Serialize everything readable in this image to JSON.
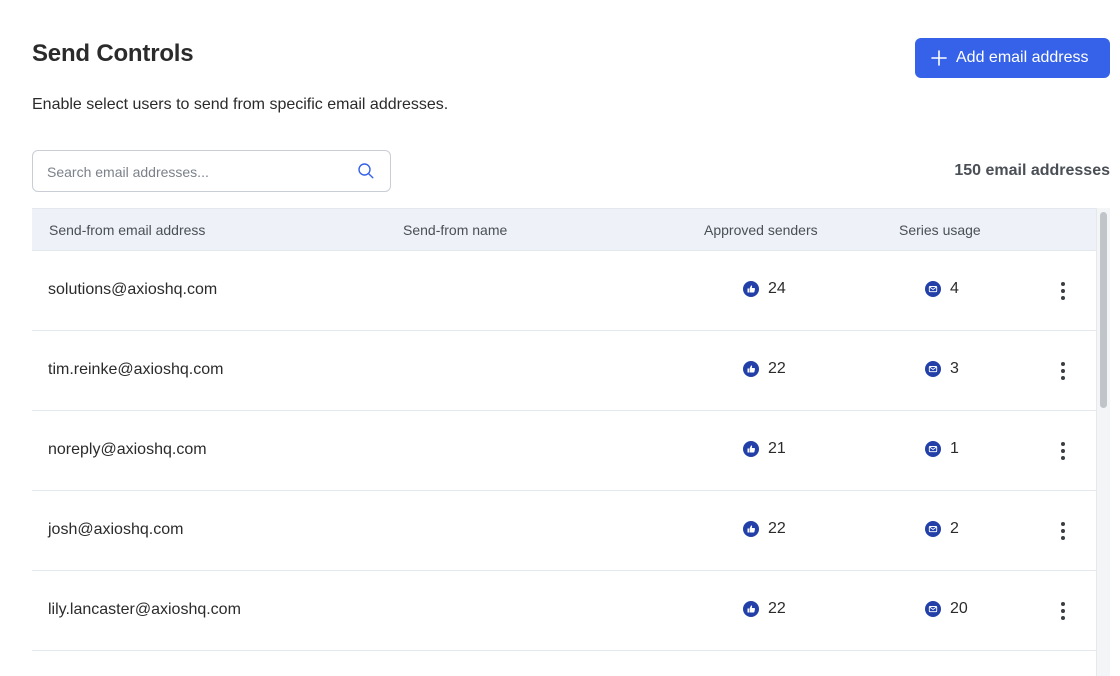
{
  "header": {
    "title": "Send Controls",
    "subtitle": "Enable select users to send from specific email addresses.",
    "add_button_label": "Add email address"
  },
  "search": {
    "placeholder": "Search email addresses...",
    "value": ""
  },
  "count_label": "150 email addresses",
  "table": {
    "columns": {
      "email": "Send-from email address",
      "name": "Send-from name",
      "approved": "Approved senders",
      "series": "Series usage"
    },
    "rows": [
      {
        "email": "solutions@axioshq.com",
        "name": "",
        "approved": "24",
        "series": "4"
      },
      {
        "email": "tim.reinke@axioshq.com",
        "name": "",
        "approved": "22",
        "series": "3"
      },
      {
        "email": "noreply@axioshq.com",
        "name": "",
        "approved": "21",
        "series": "1"
      },
      {
        "email": "josh@axioshq.com",
        "name": "",
        "approved": "22",
        "series": "2"
      },
      {
        "email": "lily.lancaster@axioshq.com",
        "name": "",
        "approved": "22",
        "series": "20"
      }
    ]
  },
  "icons": {
    "add": "plus-icon",
    "search": "search-icon",
    "approved": "thumbs-up-icon",
    "series": "envelope-icon",
    "row_menu": "more-vertical-icon"
  },
  "colors": {
    "primary": "#3562e8",
    "icon_badge": "#2340a8",
    "header_bg": "#eef2f8"
  }
}
